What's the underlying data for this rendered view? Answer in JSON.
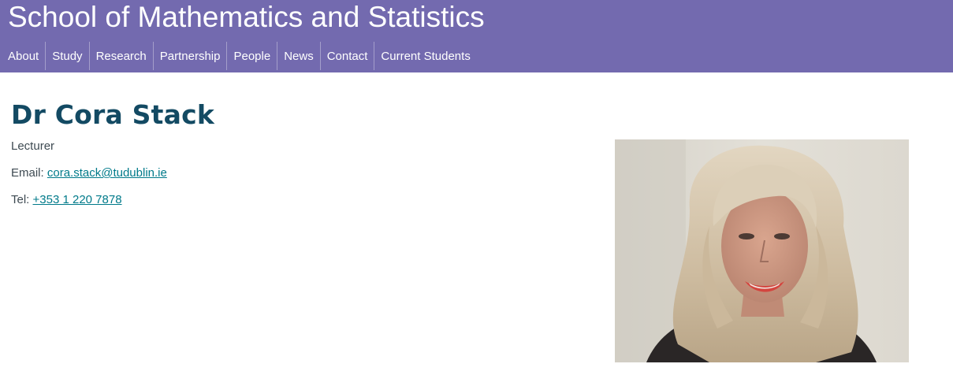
{
  "header": {
    "title": "School of Mathematics and Statistics",
    "background_color": "#736aaf"
  },
  "nav": {
    "items": [
      {
        "label": "About"
      },
      {
        "label": "Study"
      },
      {
        "label": "Research"
      },
      {
        "label": "Partnership"
      },
      {
        "label": "People"
      },
      {
        "label": "News"
      },
      {
        "label": "Contact"
      },
      {
        "label": "Current Students"
      }
    ]
  },
  "profile": {
    "name": "Dr Cora Stack",
    "role": "Lecturer",
    "email_label": "Email:",
    "email": "cora.stack@tudublin.ie",
    "tel_label": "Tel:",
    "tel": "+353 1 220 7878",
    "name_color": "#134a63",
    "link_color": "#007a8a"
  },
  "photo": {
    "icon": "profile-photo"
  }
}
